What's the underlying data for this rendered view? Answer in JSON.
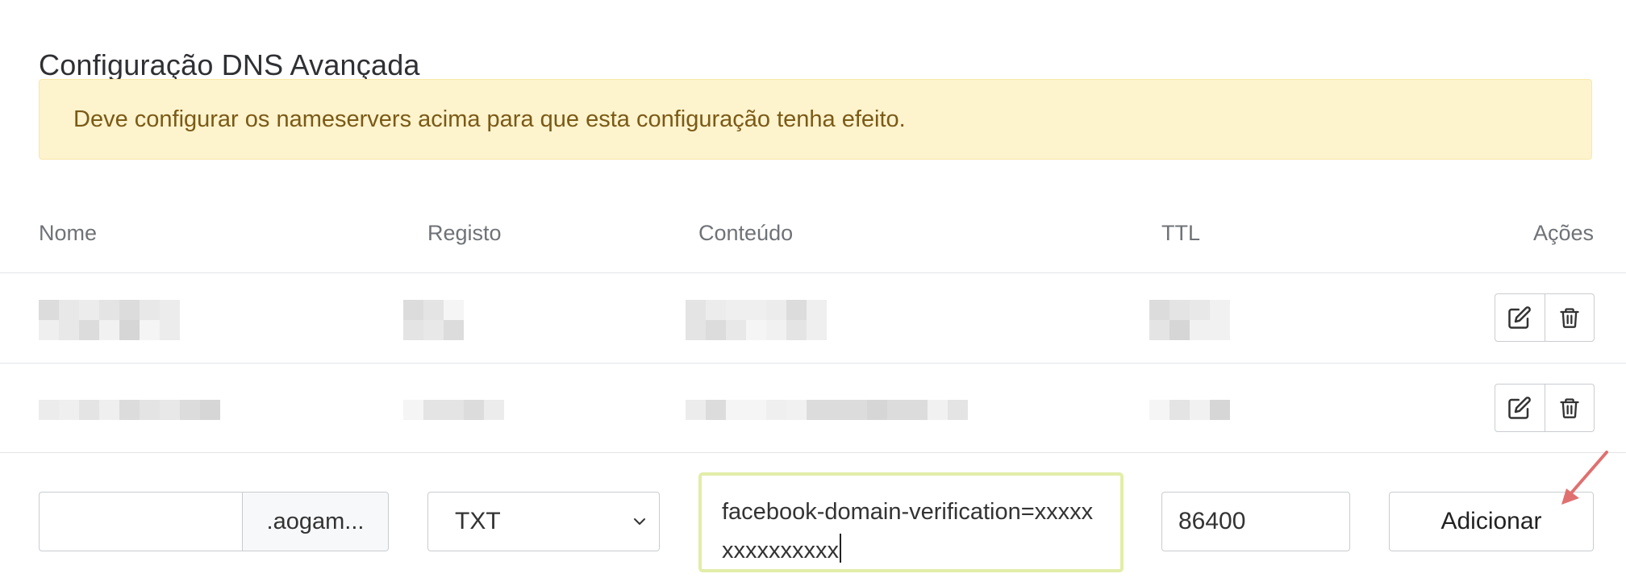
{
  "section": {
    "title": "Configuração DNS Avançada",
    "alert": "Deve configurar os nameservers acima para que esta configuração tenha efeito."
  },
  "table": {
    "headers": [
      "Nome",
      "Registo",
      "Conteúdo",
      "TTL",
      "Ações"
    ],
    "rows": [
      {
        "name": "",
        "type": "",
        "content": "",
        "ttl": ""
      },
      {
        "name": "",
        "type": "",
        "content": "",
        "ttl": ""
      }
    ]
  },
  "new_record": {
    "name_value": "",
    "domain_suffix": ".aogam...",
    "type_selected": "TXT",
    "content_value": "facebook-domain-verification=xxxxxxxxxxxxxxx",
    "ttl_value": "86400",
    "add_label": "Adicionar"
  },
  "icons": {
    "edit": "edit-icon",
    "delete": "trash-icon",
    "select": "chevron-down-icon",
    "annotation": "red-arrow"
  },
  "colors": {
    "alert_bg": "#fdf3cd",
    "alert_text": "#7a5a16",
    "focus_border": "#e2eda8",
    "arrow": "#e07070"
  }
}
